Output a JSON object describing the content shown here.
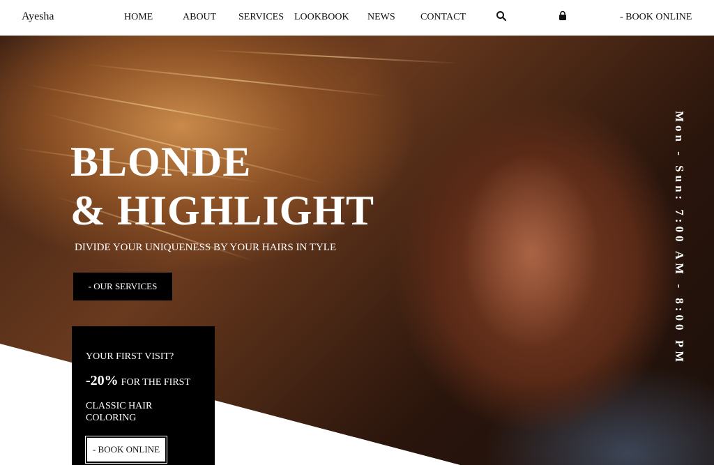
{
  "brand": "Ayesha",
  "nav": {
    "items": [
      {
        "label": "HOME"
      },
      {
        "label": "ABOUT"
      },
      {
        "label": "SERVICES"
      },
      {
        "label": "LOOKBOOK"
      },
      {
        "label": "NEWS"
      },
      {
        "label": "CONTACT"
      }
    ],
    "search_icon": "search-icon",
    "bag_icon": "shopping-bag-icon",
    "book_label": "- BOOK ONLINE"
  },
  "hero": {
    "title_line1": "BLONDE",
    "title_line2": "& HIGHLIGHT",
    "subtitle": "DIVIDE YOUR UNIQUENESS BY YOUR HAIRS IN TYLE",
    "cta_label": "- OUR SERVICES",
    "hours": "Mon - Sun: 7:00 AM - 8:00 PM"
  },
  "promo": {
    "question": "YOUR FIRST VISIT?",
    "discount": "-20%",
    "discount_suffix": "FOR THE FIRST",
    "description": "CLASSIC HAIR COLORING",
    "button_label": "- BOOK ONLINE"
  },
  "colors": {
    "header_bg": "#ffffff",
    "text_dark": "#111111",
    "button_bg": "#000000",
    "button_text": "#ffffff"
  }
}
